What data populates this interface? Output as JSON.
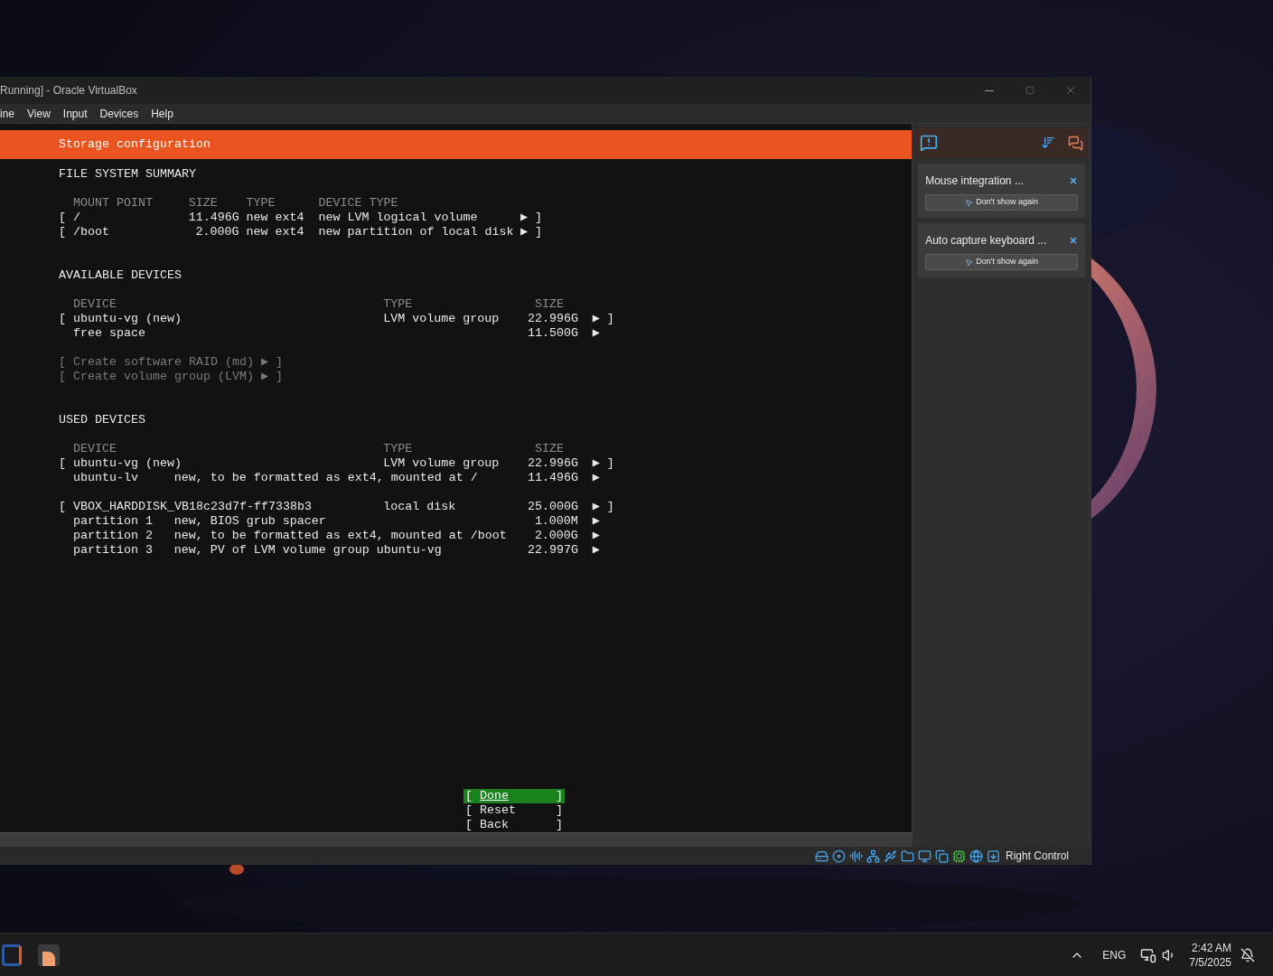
{
  "window": {
    "title": "Running] - Oracle VirtualBox"
  },
  "menu": [
    "ine",
    "View",
    "Input",
    "Devices",
    "Help"
  ],
  "installer": {
    "header": "Storage configuration",
    "file_system_summary": {
      "title": "FILE SYSTEM SUMMARY",
      "columns": {
        "mount": "MOUNT POINT",
        "size": "SIZE",
        "type": "TYPE",
        "device_type": "DEVICE TYPE"
      },
      "rows": [
        {
          "open": "[",
          "mount": "/",
          "size": "11.496G",
          "type": "new ext4",
          "device_type": "new LVM logical volume",
          "arrow": "▶",
          "close": "]"
        },
        {
          "open": "[",
          "mount": "/boot",
          "size": "2.000G",
          "type": "new ext4",
          "device_type": "new partition of local disk",
          "arrow": "▶",
          "close": "]"
        }
      ]
    },
    "available_devices": {
      "title": "AVAILABLE DEVICES",
      "columns": {
        "device": "DEVICE",
        "type": "TYPE",
        "size": "SIZE"
      },
      "rows": [
        {
          "open": "[",
          "device": "ubuntu-vg (new)",
          "type": "LVM volume group",
          "size": "22.996G",
          "arrow": "▶",
          "close": "]"
        },
        {
          "device": "free space",
          "size": "11.500G",
          "arrow": "▶"
        }
      ],
      "actions": [
        {
          "open": "[",
          "label": "Create software RAID (md)",
          "arrow": "▶",
          "close": "]",
          "disabled": true
        },
        {
          "open": "[",
          "label": "Create volume group (LVM)",
          "arrow": "▶",
          "close": "]",
          "disabled": true
        }
      ]
    },
    "used_devices": {
      "title": "USED DEVICES",
      "columns": {
        "device": "DEVICE",
        "type": "TYPE",
        "size": "SIZE"
      },
      "groups": [
        {
          "rows": [
            {
              "open": "[",
              "device": "ubuntu-vg (new)",
              "type": "LVM volume group",
              "size": "22.996G",
              "arrow": "▶",
              "close": "]"
            },
            {
              "device": "ubuntu-lv",
              "description": "new, to be formatted as ext4, mounted at /",
              "size": "11.496G",
              "arrow": "▶"
            }
          ]
        },
        {
          "rows": [
            {
              "open": "[",
              "device": "VBOX_HARDDISK_VB18c23d7f-ff7338b3",
              "type": "local disk",
              "size": "25.000G",
              "arrow": "▶",
              "close": "]"
            },
            {
              "device": "partition 1",
              "description": "new, BIOS grub spacer",
              "size": "1.000M",
              "arrow": "▶"
            },
            {
              "device": "partition 2",
              "description": "new, to be formatted as ext4, mounted at /boot",
              "size": "2.000G",
              "arrow": "▶"
            },
            {
              "device": "partition 3",
              "description": "new, PV of LVM volume group ubuntu-vg",
              "size": "22.997G",
              "arrow": "▶"
            }
          ]
        }
      ]
    },
    "buttons": [
      {
        "open": "[",
        "label": "Done",
        "close": "]",
        "selected": true
      },
      {
        "open": "[",
        "label": "Reset",
        "close": "]",
        "selected": false
      },
      {
        "open": "[",
        "label": "Back",
        "close": "]",
        "selected": false
      }
    ]
  },
  "notifications": [
    {
      "title": "Mouse integration ...",
      "button": "Don't show again"
    },
    {
      "title": "Auto capture keyboard ...",
      "button": "Don't show again"
    }
  ],
  "status_bar": {
    "host_key": "Right Control"
  },
  "taskbar": {
    "language": "ENG",
    "time": "2:42 AM",
    "date": "7/5/2025"
  }
}
